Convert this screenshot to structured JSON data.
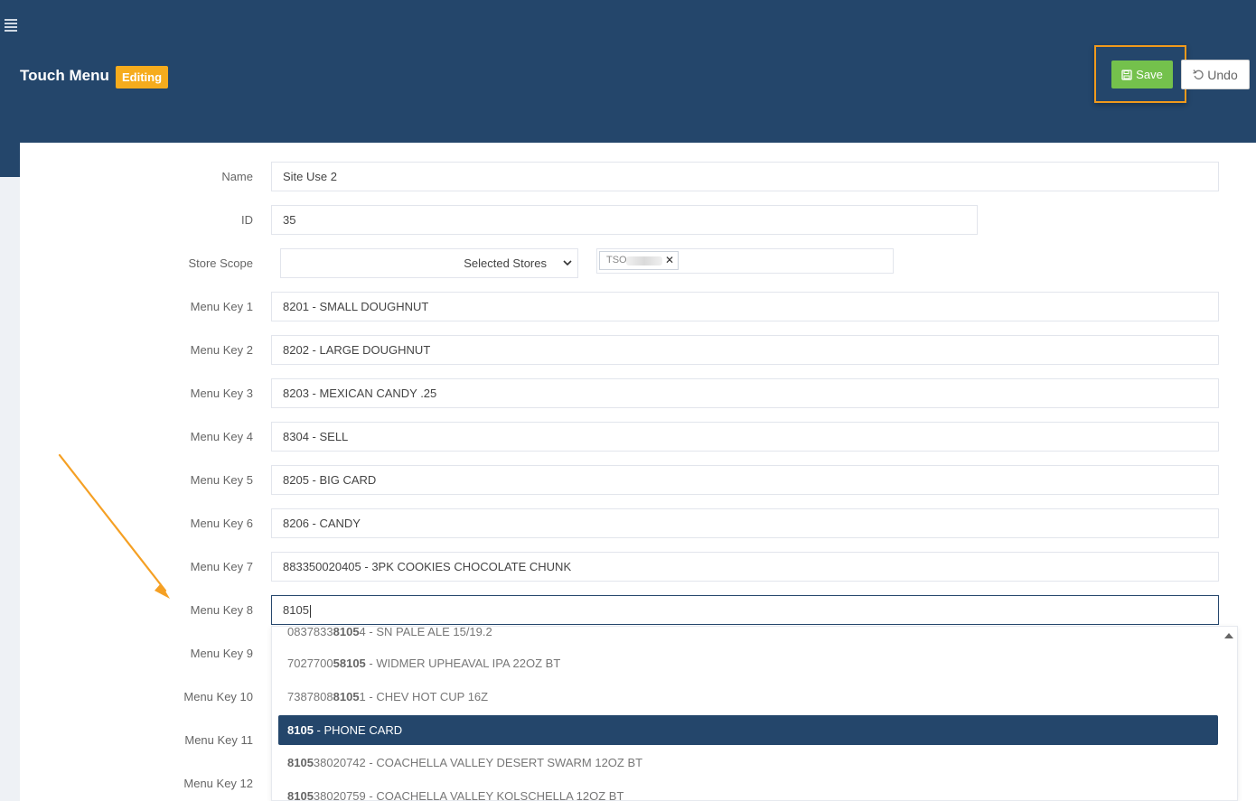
{
  "header": {
    "title": "Touch Menu",
    "status_badge": "Editing",
    "save_label": "Save",
    "undo_label": "Undo",
    "background_color": "#24466b",
    "badge_color": "#f6ac1d",
    "save_color": "#74c14c"
  },
  "form": {
    "name_label": "Name",
    "name_value": "Site Use 2",
    "id_label": "ID",
    "id_value": "35",
    "store_scope_label": "Store Scope",
    "store_scope_value": "Selected Stores",
    "store_tag": "TSO",
    "menu_keys": [
      {
        "label": "Menu Key 1",
        "value": "8201 - SMALL DOUGHNUT"
      },
      {
        "label": "Menu Key 2",
        "value": "8202 - LARGE DOUGHNUT"
      },
      {
        "label": "Menu Key 3",
        "value": "8203 - MEXICAN CANDY .25"
      },
      {
        "label": "Menu Key 4",
        "value": "8304 - SELL"
      },
      {
        "label": "Menu Key 5",
        "value": "8205 - BIG CARD"
      },
      {
        "label": "Menu Key 6",
        "value": "8206 - CANDY"
      },
      {
        "label": "Menu Key 7",
        "value": "883350020405 - 3PK COOKIES CHOCOLATE CHUNK"
      },
      {
        "label": "Menu Key 8",
        "value": "8105"
      },
      {
        "label": "Menu Key 9",
        "value": ""
      },
      {
        "label": "Menu Key 10",
        "value": ""
      },
      {
        "label": "Menu Key 11",
        "value": ""
      },
      {
        "label": "Menu Key 12",
        "value": ""
      }
    ]
  },
  "autocomplete": {
    "query": "8105",
    "items": [
      {
        "pre": "0837833",
        "match": "8105",
        "post": "4 - SN PALE ALE 15/19.2",
        "selected": false
      },
      {
        "pre": "7027700",
        "match": "58105",
        "post": " - WIDMER UPHEAVAL IPA 22OZ BT",
        "selected": false
      },
      {
        "pre": "7387808",
        "match": "8105",
        "post": "1 - CHEV HOT CUP 16Z",
        "selected": false
      },
      {
        "pre": "",
        "match": "8105",
        "post": " - PHONE CARD",
        "selected": true
      },
      {
        "pre": "",
        "match": "8105",
        "post": "38020742 - COACHELLA VALLEY DESERT SWARM 12OZ BT",
        "selected": false
      },
      {
        "pre": "",
        "match": "8105",
        "post": "38020759 - COACHELLA VALLEY KOLSCHELLA 12OZ BT",
        "selected": false
      }
    ]
  }
}
